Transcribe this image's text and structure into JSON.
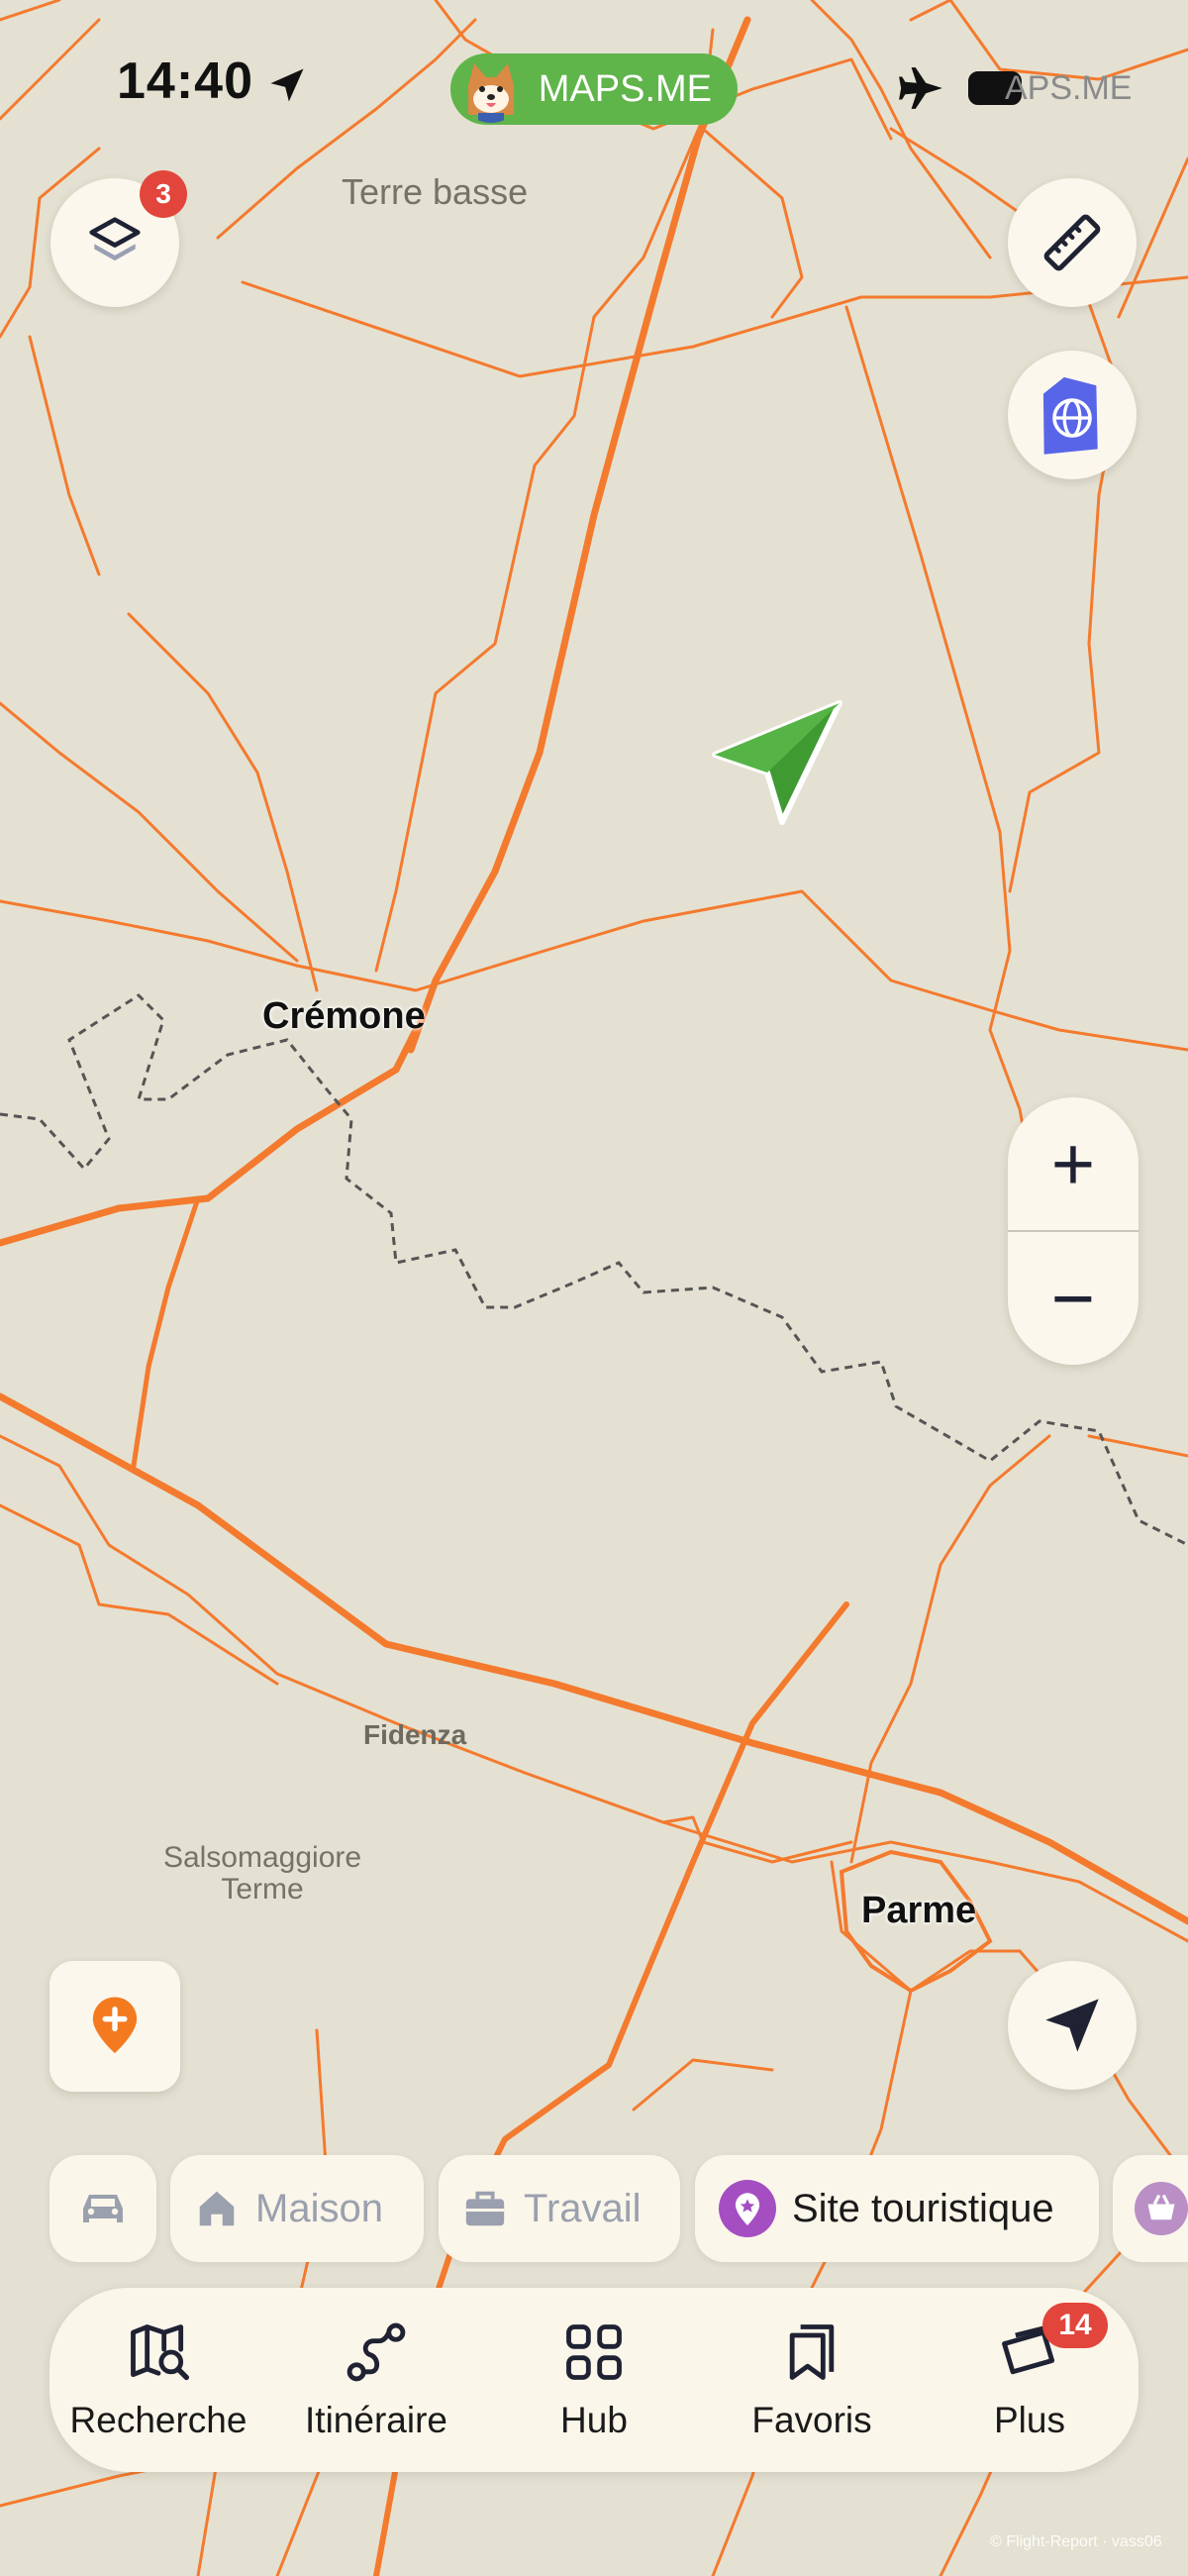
{
  "status_bar": {
    "time": "14:40",
    "app_name": "MAPS.ME",
    "battery_overlay_text": "APS.ME"
  },
  "map": {
    "labels": {
      "terre_basse": "Terre basse",
      "cremona": "Crémone",
      "fidenza": "Fidenza",
      "salsomaggiore_line1": "Salsomaggiore",
      "salsomaggiore_line2": "Terme",
      "parma": "Parme"
    },
    "road_color": "#f47a2e",
    "border_color": "#555555",
    "background_color": "#e4e1d2",
    "position_arrow_color": "#3f9a32"
  },
  "controls": {
    "layers_badge": "3",
    "layers_icon": "layers-icon",
    "ruler_icon": "ruler-icon",
    "esim_icon": "esim-globe-icon",
    "zoom_in": "+",
    "zoom_out": "−",
    "add_place_icon": "add-place-pin-icon",
    "my_location_icon": "navigation-arrow-icon"
  },
  "chips": [
    {
      "label": "",
      "icon": "car-icon"
    },
    {
      "label": "Maison",
      "icon": "home-icon"
    },
    {
      "label": "Travail",
      "icon": "briefcase-icon"
    },
    {
      "label": "Site touristique",
      "icon": "attraction-pin-icon"
    },
    {
      "label": "",
      "icon": "basket-icon"
    }
  ],
  "bottom_nav": {
    "items": [
      {
        "label": "Recherche",
        "icon": "map-search-icon"
      },
      {
        "label": "Itinéraire",
        "icon": "route-icon"
      },
      {
        "label": "Hub",
        "icon": "grid-icon"
      },
      {
        "label": "Favoris",
        "icon": "bookmarks-icon"
      },
      {
        "label": "Plus",
        "icon": "tickets-icon",
        "badge": "14"
      }
    ]
  },
  "watermark": "© Flight-Report · vass06"
}
